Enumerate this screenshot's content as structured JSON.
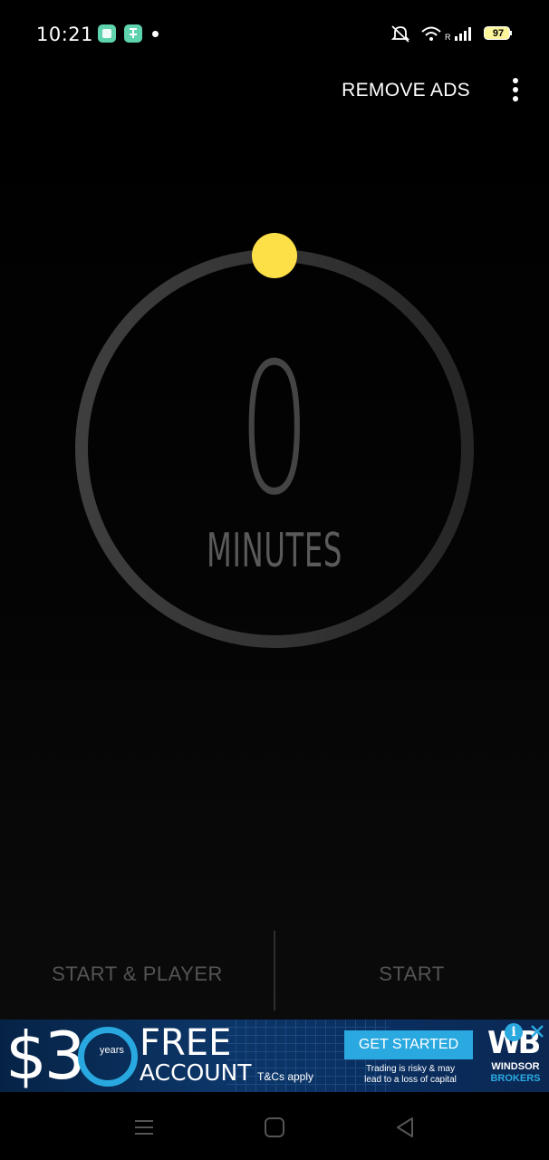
{
  "status_bar": {
    "time": "10:21",
    "battery": "97",
    "network_label": "R"
  },
  "app_bar": {
    "remove_ads_label": "REMOVE ADS",
    "menu_icon": "more-vert-icon"
  },
  "timer": {
    "value": "0",
    "unit_label": "MINUTES",
    "accent_color": "#fde047",
    "track_color": "#3a3a3a"
  },
  "buttons": {
    "start_player_label": "START & PLAYER",
    "start_label": "START"
  },
  "ad": {
    "amount_prefix": "$3",
    "amount_suffix": "years",
    "headline": "FREE",
    "subheadline": "ACCOUNT",
    "tcs": "T&Cs apply",
    "cta": "GET STARTED",
    "risk_line1": "Trading is risky & may",
    "risk_line2": "lead to a loss of capital",
    "brand_line1": "WINDSOR",
    "brand_line2": "BROKERS",
    "logo_text": "WB",
    "info_glyph": "i"
  },
  "nav_bar": {
    "items": [
      "menu-icon",
      "home-icon",
      "back-icon"
    ]
  }
}
